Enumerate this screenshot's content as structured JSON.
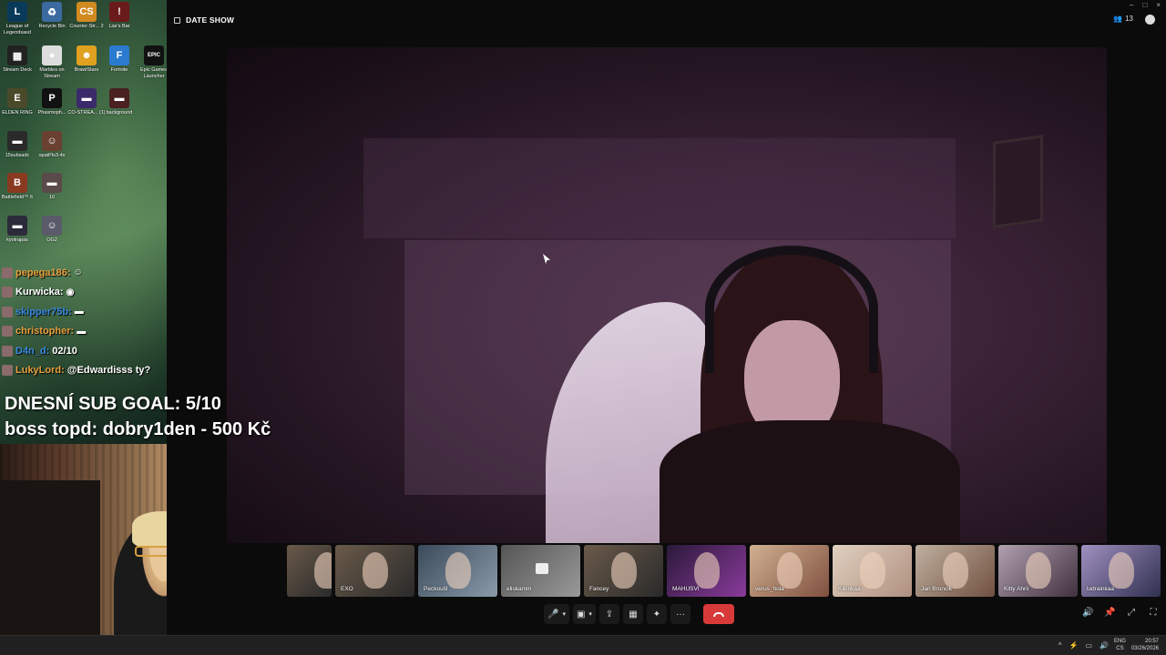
{
  "desktop": {
    "icons": [
      {
        "label": "League of Legendsasd",
        "glyph": "L",
        "color": "#0a3a5a"
      },
      {
        "label": "Recycle Bin",
        "glyph": "♻",
        "color": "#3a6aa0"
      },
      {
        "label": "Counter-Str... 2",
        "glyph": "CS",
        "color": "#d08a20"
      },
      {
        "label": "Liar's Bar",
        "glyph": "!",
        "color": "#6a1a1a"
      },
      {
        "label": "Stream Deck",
        "glyph": "▦",
        "color": "#222"
      },
      {
        "label": "Marbles on Stream",
        "glyph": "●",
        "color": "#ddd"
      },
      {
        "label": "BrawlStars",
        "glyph": "☻",
        "color": "#e0a020"
      },
      {
        "label": "Fortnite",
        "glyph": "F",
        "color": "#2a7ad0"
      },
      {
        "label": "Epic Games Launcher",
        "glyph": "EPIC",
        "color": "#111"
      },
      {
        "label": "ELDEN RING",
        "glyph": "E",
        "color": "#4a4a2a"
      },
      {
        "label": "Phasmoph...",
        "glyph": "P",
        "color": "#111"
      },
      {
        "label": "CO-STREA... (1)",
        "glyph": "▬",
        "color": "#3a2a6a"
      },
      {
        "label": "background",
        "glyph": "▬",
        "color": "#4a2020"
      },
      {
        "label": "15subsadc",
        "glyph": "▬",
        "color": "#2a2a2a"
      },
      {
        "label": "opatPls3-4x",
        "glyph": "☺",
        "color": "#6a4030"
      },
      {
        "label": "Battlefield™ 6",
        "glyph": "B",
        "color": "#8a3a20"
      },
      {
        "label": "10",
        "glyph": "▬",
        "color": "#5a4a4a"
      },
      {
        "label": "kyotrapas",
        "glyph": "▬",
        "color": "#2a2a3a"
      },
      {
        "label": "OG2",
        "glyph": "☺",
        "color": "#5a5a6a"
      }
    ]
  },
  "chat": [
    {
      "name": "pepega186:",
      "name_color": "#e8a040",
      "msg": "",
      "badge": "☺"
    },
    {
      "name": "Kurwicka:",
      "name_color": "#ffffff",
      "msg": "",
      "badge": "◉"
    },
    {
      "name": "skipper75b:",
      "name_color": "#3a8ae0",
      "msg": "",
      "badge": "▬"
    },
    {
      "name": "christopher:",
      "name_color": "#e8a040",
      "msg": "",
      "badge": "▬"
    },
    {
      "name": "D4n_d:",
      "name_color": "#3a8ae0",
      "msg": "02/10",
      "badge": ""
    },
    {
      "name": "LukyLord:",
      "name_color": "#e8a040",
      "msg": "@Edwardisss ty?",
      "badge": ""
    }
  ],
  "overlay": {
    "sub_goal": "DNESNÍ SUB GOAL: 5/10",
    "boss": "boss topd:  dobry1den - 500 Kč"
  },
  "app": {
    "title": "DATE SHOW",
    "participant_count": "13",
    "window_controls": [
      "–",
      "□",
      "×"
    ]
  },
  "participants": [
    {
      "name": "",
      "style": "vid1"
    },
    {
      "name": "EXO",
      "style": "vid1"
    },
    {
      "name": "Peckoušl",
      "style": "vid2"
    },
    {
      "name": "eliskamm",
      "style": "vid3"
    },
    {
      "name": "Fancey",
      "style": "vid1"
    },
    {
      "name": "MAHUSVI",
      "style": "vid4"
    },
    {
      "name": "verus_hola",
      "style": "vid5"
    },
    {
      "name": "Kikinkaa",
      "style": "vid6"
    },
    {
      "name": "Jan Bruncik",
      "style": "vid7"
    },
    {
      "name": "Kitty Ahrii",
      "style": "vid8"
    },
    {
      "name": "ludrainkaa",
      "style": "vid9"
    }
  ],
  "controls": {
    "mic": "🎤",
    "camera": "▣",
    "share": "⇪",
    "apps": "▦",
    "activities": "✦",
    "more": "···",
    "right": [
      "🔊",
      "📌",
      "⤢",
      "⛶"
    ]
  },
  "taskbar": {
    "lang_top": "ENG",
    "lang_bottom": "CS",
    "time": "20:57",
    "date": "03/26/2026",
    "tray_icons": [
      "^",
      "⚡",
      "▭",
      "🔊"
    ]
  }
}
